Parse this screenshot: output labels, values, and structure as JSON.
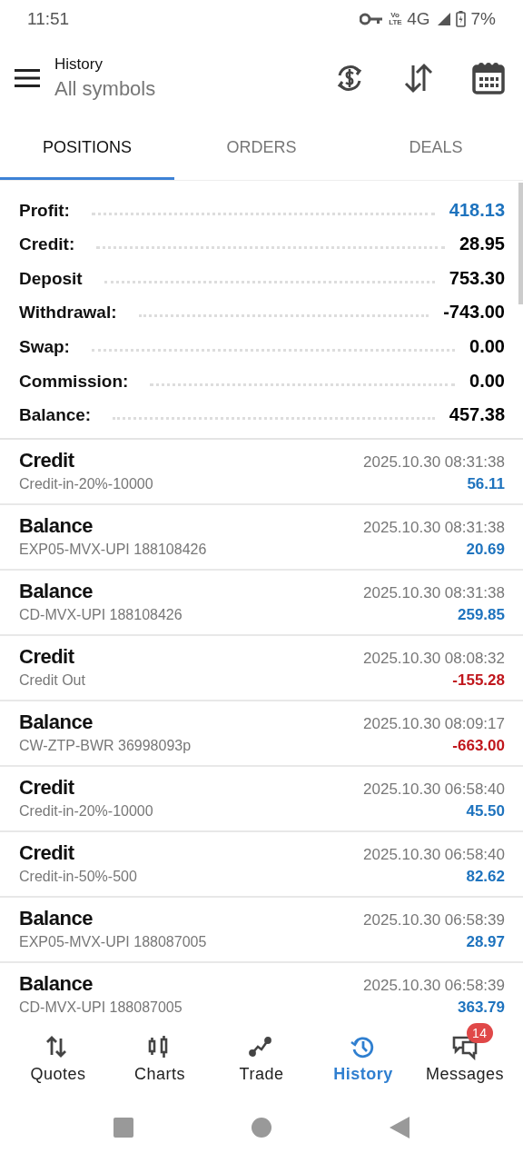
{
  "status_bar": {
    "time": "11:51",
    "volte": "Vo LTE",
    "network": "4G",
    "battery": "7%"
  },
  "header": {
    "title": "History",
    "subtitle": "All symbols"
  },
  "tabs": [
    {
      "label": "POSITIONS",
      "selected": true
    },
    {
      "label": "ORDERS",
      "selected": false
    },
    {
      "label": "DEALS",
      "selected": false
    }
  ],
  "summary": [
    {
      "label": "Profit:",
      "value": "418.13",
      "color": "#1e73be"
    },
    {
      "label": "Credit:",
      "value": "28.95",
      "color": "#000000"
    },
    {
      "label": "Deposit",
      "value": "753.30",
      "color": "#000000"
    },
    {
      "label": "Withdrawal:",
      "value": "-743.00",
      "color": "#000000"
    },
    {
      "label": "Swap:",
      "value": "0.00",
      "color": "#000000"
    },
    {
      "label": "Commission:",
      "value": "0.00",
      "color": "#000000"
    },
    {
      "label": "Balance:",
      "value": "457.38",
      "color": "#000000"
    }
  ],
  "deals": [
    {
      "type": "Credit",
      "comment": "Credit-in-20%-10000",
      "time": "2025.10.30 08:31:38",
      "amount": "56.11",
      "color": "#1e73be"
    },
    {
      "type": "Balance",
      "comment": "EXP05-MVX-UPI 188108426",
      "time": "2025.10.30 08:31:38",
      "amount": "20.69",
      "color": "#1e73be"
    },
    {
      "type": "Balance",
      "comment": "CD-MVX-UPI 188108426",
      "time": "2025.10.30 08:31:38",
      "amount": "259.85",
      "color": "#1e73be"
    },
    {
      "type": "Credit",
      "comment": "Credit Out",
      "time": "2025.10.30 08:08:32",
      "amount": "-155.28",
      "color": "#c0161c"
    },
    {
      "type": "Balance",
      "comment": "CW-ZTP-BWR 36998093p",
      "time": "2025.10.30 08:09:17",
      "amount": "-663.00",
      "color": "#c0161c"
    },
    {
      "type": "Credit",
      "comment": "Credit-in-20%-10000",
      "time": "2025.10.30 06:58:40",
      "amount": "45.50",
      "color": "#1e73be"
    },
    {
      "type": "Credit",
      "comment": "Credit-in-50%-500",
      "time": "2025.10.30 06:58:40",
      "amount": "82.62",
      "color": "#1e73be"
    },
    {
      "type": "Balance",
      "comment": "EXP05-MVX-UPI 188087005",
      "time": "2025.10.30 06:58:39",
      "amount": "28.97",
      "color": "#1e73be"
    },
    {
      "type": "Balance",
      "comment": "CD-MVX-UPI 188087005",
      "time": "2025.10.30 06:58:39",
      "amount": "363.79",
      "color": "#1e73be"
    }
  ],
  "bottom_nav": [
    {
      "kind": "quotes",
      "label": "Quotes",
      "selected": false
    },
    {
      "kind": "charts",
      "label": "Charts",
      "selected": false
    },
    {
      "kind": "trade",
      "label": "Trade",
      "selected": false
    },
    {
      "kind": "history",
      "label": "History",
      "selected": true
    },
    {
      "kind": "messages",
      "label": "Messages",
      "selected": false,
      "badge": "14"
    }
  ]
}
